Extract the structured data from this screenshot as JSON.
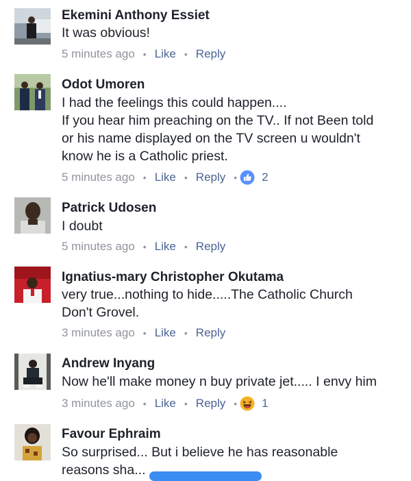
{
  "comments": [
    {
      "author": "Ekemini Anthony Essiet",
      "lines": [
        "It was obvious!"
      ],
      "time": "5 minutes ago",
      "like": "Like",
      "reply": "Reply",
      "reaction_count": ""
    },
    {
      "author": "Odot Umoren",
      "lines": [
        "I had the feelings this could happen....",
        "If you hear him preaching on the TV.. If not Been told",
        "or his name displayed on the TV screen u wouldn't",
        "know he is a Catholic priest."
      ],
      "time": "5 minutes ago",
      "like": "Like",
      "reply": "Reply",
      "reaction_icon": "like-icon",
      "reaction_count": "2"
    },
    {
      "author": "Patrick Udosen",
      "lines": [
        "I doubt"
      ],
      "time": "5 minutes ago",
      "like": "Like",
      "reply": "Reply",
      "reaction_count": ""
    },
    {
      "author": "Ignatius-mary Christopher Okutama",
      "lines": [
        "very true...nothing to hide.....The Catholic Church",
        "Don't Grovel."
      ],
      "time": "3 minutes ago",
      "like": "Like",
      "reply": "Reply",
      "reaction_count": ""
    },
    {
      "author": "Andrew Inyang",
      "lines": [
        "Now he'll make money n buy private jet..... I envy him"
      ],
      "time": "3 minutes ago",
      "like": "Like",
      "reply": "Reply",
      "reaction_icon": "haha-icon",
      "reaction_count": "1"
    },
    {
      "author": "Favour Ephraim",
      "lines": [
        "So surprised... But i believe he has reasonable",
        "reasons sha..."
      ],
      "time": "",
      "like": "",
      "reply": "",
      "reaction_count": ""
    }
  ],
  "colors": {
    "name": "#1d2129",
    "meta": "#90949c",
    "link": "#4b6394",
    "like_blue": "#5890ff",
    "haha_yellow": "#f7b125",
    "accent_pill": "#3b8cf0"
  }
}
